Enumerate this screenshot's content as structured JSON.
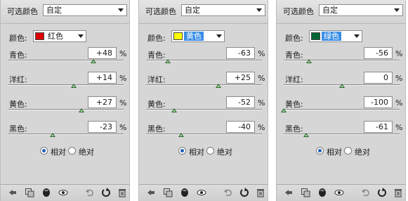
{
  "panels": [
    {
      "title": "可选颜色",
      "preset": "自定",
      "colors_label": "颜色:",
      "color_name": "红色",
      "swatch_color": "#dd0000",
      "highlighted": false,
      "percent_sign": "%",
      "rows": [
        {
          "label": "青色:",
          "value": "+48",
          "level": 0.74
        },
        {
          "label": "洋红:",
          "value": "+14",
          "level": 0.57
        },
        {
          "label": "黄色:",
          "value": "+27",
          "level": 0.635
        },
        {
          "label": "黑色:",
          "value": "-23",
          "level": 0.385
        }
      ],
      "radio_relative": "相对",
      "radio_absolute": "绝对",
      "selected_method": "relative"
    },
    {
      "title": "可选颜色",
      "preset": "自定",
      "colors_label": "颜色:",
      "color_name": "黄色",
      "swatch_color": "#ffff00",
      "highlighted": true,
      "percent_sign": "%",
      "rows": [
        {
          "label": "青色:",
          "value": "-63",
          "level": 0.185
        },
        {
          "label": "洋红:",
          "value": "+25",
          "level": 0.625
        },
        {
          "label": "黄色:",
          "value": "-52",
          "level": 0.24
        },
        {
          "label": "黑色:",
          "value": "-40",
          "level": 0.3
        }
      ],
      "radio_relative": "相对",
      "radio_absolute": "绝对",
      "selected_method": "relative"
    },
    {
      "title": "可选颜色",
      "preset": "自定",
      "colors_label": "颜色:",
      "color_name": "绿色",
      "swatch_color": "#006633",
      "highlighted": true,
      "percent_sign": "%",
      "rows": [
        {
          "label": "青色:",
          "value": "-56",
          "level": 0.22
        },
        {
          "label": "洋红:",
          "value": "0",
          "level": 0.5
        },
        {
          "label": "黄色:",
          "value": "-100",
          "level": 0.0
        },
        {
          "label": "黑色:",
          "value": "-61",
          "level": 0.195
        }
      ],
      "radio_relative": "相对",
      "radio_absolute": "绝对",
      "selected_method": "relative"
    }
  ],
  "footer_icons": [
    "back-arrow-icon",
    "clip-layer-icon",
    "visibility-mask-icon",
    "eye-icon",
    "undo-icon",
    "reset-icon",
    "trash-icon"
  ]
}
